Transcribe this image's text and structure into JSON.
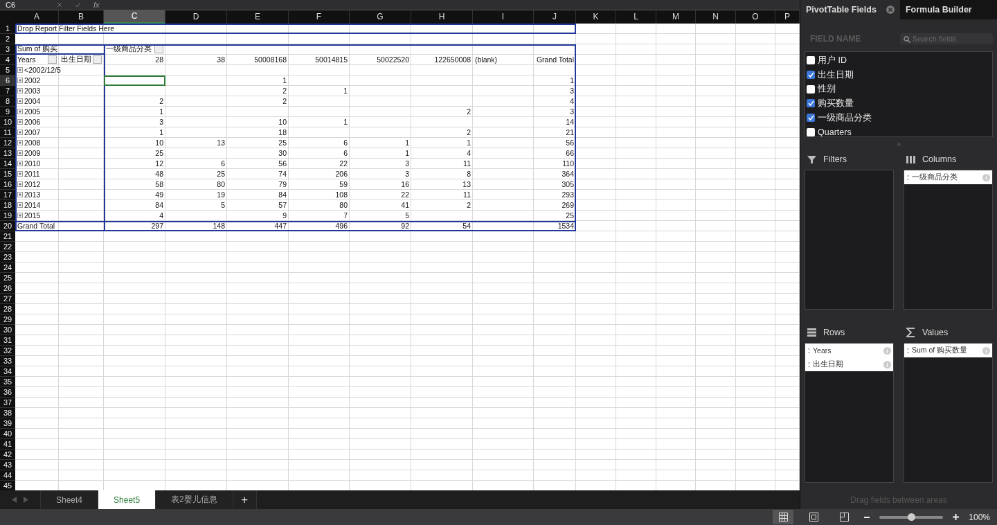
{
  "formula_bar": {
    "name_box": "C6",
    "function_label": "fx"
  },
  "sheet": {
    "columns": [
      {
        "label": "A",
        "selected": false
      },
      {
        "label": "B",
        "selected": false
      },
      {
        "label": "C",
        "selected": true
      },
      {
        "label": "D",
        "selected": false
      },
      {
        "label": "E",
        "selected": false
      },
      {
        "label": "F",
        "selected": false
      },
      {
        "label": "G",
        "selected": false
      },
      {
        "label": "H",
        "selected": false
      },
      {
        "label": "I",
        "selected": false
      },
      {
        "label": "J",
        "selected": false
      },
      {
        "label": "K",
        "selected": false
      },
      {
        "label": "L",
        "selected": false
      },
      {
        "label": "M",
        "selected": false
      },
      {
        "label": "N",
        "selected": false
      },
      {
        "label": "O",
        "selected": false
      },
      {
        "label": "P",
        "selected": false
      }
    ],
    "rows": [
      {
        "label": "1",
        "selected": false
      },
      {
        "label": "2",
        "selected": false
      },
      {
        "label": "3",
        "selected": false
      },
      {
        "label": "4",
        "selected": false
      },
      {
        "label": "5",
        "selected": false
      },
      {
        "label": "6",
        "selected": true
      },
      {
        "label": "7",
        "selected": false
      },
      {
        "label": "8",
        "selected": false
      },
      {
        "label": "9",
        "selected": false
      },
      {
        "label": "10",
        "selected": false
      },
      {
        "label": "11",
        "selected": false
      },
      {
        "label": "12",
        "selected": false
      },
      {
        "label": "13",
        "selected": false
      },
      {
        "label": "14",
        "selected": false
      },
      {
        "label": "15",
        "selected": false
      },
      {
        "label": "16",
        "selected": false
      },
      {
        "label": "17",
        "selected": false
      },
      {
        "label": "18",
        "selected": false
      },
      {
        "label": "19",
        "selected": false
      },
      {
        "label": "20",
        "selected": false
      },
      {
        "label": "21",
        "selected": false
      },
      {
        "label": "22",
        "selected": false
      },
      {
        "label": "23",
        "selected": false
      },
      {
        "label": "24",
        "selected": false
      },
      {
        "label": "25",
        "selected": false
      },
      {
        "label": "26",
        "selected": false
      },
      {
        "label": "27",
        "selected": false
      },
      {
        "label": "28",
        "selected": false
      },
      {
        "label": "29",
        "selected": false
      },
      {
        "label": "30",
        "selected": false
      },
      {
        "label": "31",
        "selected": false
      },
      {
        "label": "32",
        "selected": false
      },
      {
        "label": "33",
        "selected": false
      },
      {
        "label": "34",
        "selected": false
      },
      {
        "label": "35",
        "selected": false
      },
      {
        "label": "36",
        "selected": false
      },
      {
        "label": "37",
        "selected": false
      },
      {
        "label": "38",
        "selected": false
      },
      {
        "label": "39",
        "selected": false
      },
      {
        "label": "40",
        "selected": false
      },
      {
        "label": "41",
        "selected": false
      },
      {
        "label": "42",
        "selected": false
      },
      {
        "label": "43",
        "selected": false
      },
      {
        "label": "44",
        "selected": false
      },
      {
        "label": "45",
        "selected": false
      }
    ]
  },
  "pivot": {
    "filter_drop_hint": "Drop Report Filter Fields Here",
    "values_label": "Sum of 购买",
    "column_field": "一级商品分类",
    "row_fields": [
      "Years",
      "出生日期"
    ],
    "column_headers": [
      "28",
      "38",
      "50008168",
      "50014815",
      "50022520",
      "122650008",
      "(blank)"
    ],
    "grand_total_header": "Grand Total",
    "rows": [
      {
        "label": "<2002/12/5"
      },
      {
        "label": "2002",
        "E": "1",
        "J": "1"
      },
      {
        "label": "2003",
        "E": "2",
        "F": "1",
        "J": "3"
      },
      {
        "label": "2004",
        "C": "2",
        "E": "2",
        "J": "4"
      },
      {
        "label": "2005",
        "C": "1",
        "H": "2",
        "J": "3"
      },
      {
        "label": "2006",
        "C": "3",
        "E": "10",
        "F": "1",
        "J": "14"
      },
      {
        "label": "2007",
        "C": "1",
        "E": "18",
        "H": "2",
        "J": "21"
      },
      {
        "label": "2008",
        "C": "10",
        "D": "13",
        "E": "25",
        "F": "6",
        "G": "1",
        "H": "1",
        "J": "56"
      },
      {
        "label": "2009",
        "C": "25",
        "E": "30",
        "F": "6",
        "G": "1",
        "H": "4",
        "J": "66"
      },
      {
        "label": "2010",
        "C": "12",
        "D": "6",
        "E": "56",
        "F": "22",
        "G": "3",
        "H": "11",
        "J": "110"
      },
      {
        "label": "2011",
        "C": "48",
        "D": "25",
        "E": "74",
        "F": "206",
        "G": "3",
        "H": "8",
        "J": "364"
      },
      {
        "label": "2012",
        "C": "58",
        "D": "80",
        "E": "79",
        "F": "59",
        "G": "16",
        "H": "13",
        "J": "305"
      },
      {
        "label": "2013",
        "C": "49",
        "D": "19",
        "E": "84",
        "F": "108",
        "G": "22",
        "H": "11",
        "J": "293"
      },
      {
        "label": "2014",
        "C": "84",
        "D": "5",
        "E": "57",
        "F": "80",
        "G": "41",
        "H": "2",
        "J": "269"
      },
      {
        "label": "2015",
        "C": "4",
        "E": "9",
        "F": "7",
        "G": "5",
        "J": "25"
      }
    ],
    "grand_total": {
      "label": "Grand Total",
      "C": "297",
      "D": "148",
      "E": "447",
      "F": "496",
      "G": "92",
      "H": "54",
      "J": "1534"
    }
  },
  "sheet_tabs": [
    {
      "label": "Sheet4",
      "selected": false
    },
    {
      "label": "Sheet5",
      "selected": true
    },
    {
      "label": "表2婴儿信息",
      "selected": false
    }
  ],
  "add_sheet": "+",
  "panel": {
    "tabs": [
      {
        "label": "PivotTable Fields",
        "selected": true
      },
      {
        "label": "Formula Builder",
        "selected": false
      }
    ],
    "field_name_heading": "FIELD NAME",
    "search": {
      "placeholder": "Search fields"
    },
    "fields": [
      {
        "label": "用户 ID",
        "checked": false
      },
      {
        "label": "出生日期",
        "checked": true
      },
      {
        "label": "性别",
        "checked": false
      },
      {
        "label": "购买数量",
        "checked": true
      },
      {
        "label": "一级商品分类",
        "checked": true
      },
      {
        "label": "Quarters",
        "checked": false
      }
    ],
    "areas": [
      {
        "kind": "filters",
        "title": "Filters"
      },
      {
        "kind": "columns",
        "title": "Columns",
        "items": [
          "一级商品分类"
        ]
      },
      {
        "kind": "rows",
        "title": "Rows",
        "items": [
          "Years",
          "出生日期"
        ]
      },
      {
        "kind": "values",
        "title": "Values",
        "items": [
          "Sum of 购买数量"
        ]
      }
    ],
    "hint": "Drag fields between areas"
  },
  "status_bar": {
    "views": [
      {
        "kind": "normal",
        "selected": true
      },
      {
        "kind": "page-layout",
        "selected": false
      },
      {
        "kind": "page-break",
        "selected": false
      }
    ],
    "zoom": {
      "level": 0.5,
      "reading": "100%"
    }
  }
}
